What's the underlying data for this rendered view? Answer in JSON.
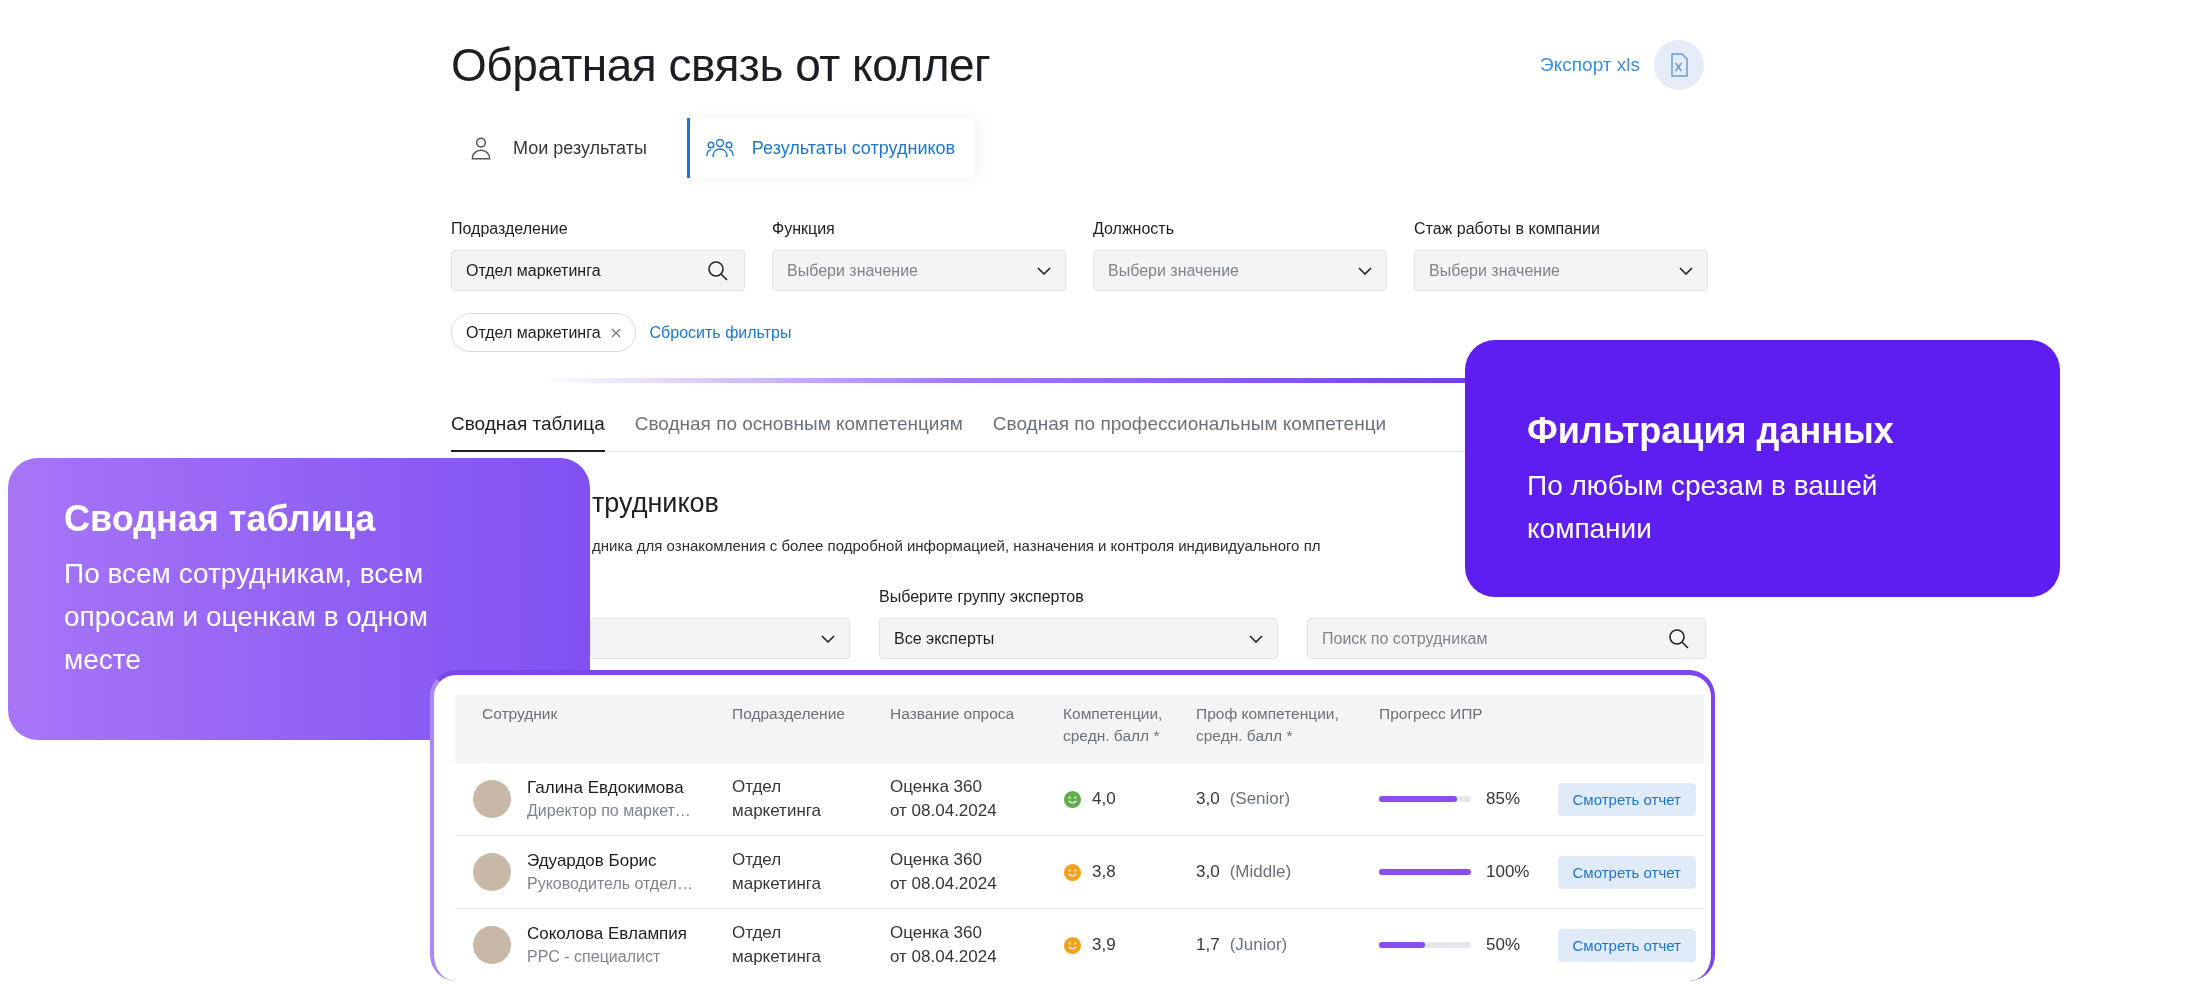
{
  "page": {
    "title": "Обратная связь от коллег",
    "export": "Экспорт xls"
  },
  "tabs": [
    {
      "label": "Мои результаты",
      "selected": false,
      "kind": "personal"
    },
    {
      "label": "Результаты сотрудников",
      "selected": true,
      "kind": "team"
    }
  ],
  "filters": [
    {
      "label": "Подразделение",
      "kind": "search",
      "value": "Отдел маркетинга"
    },
    {
      "label": "Функция",
      "kind": "select",
      "placeholder": "Выбери значение"
    },
    {
      "label": "Должность",
      "kind": "select",
      "placeholder": "Выбери значение"
    },
    {
      "label": "Стаж работы в компании",
      "kind": "select",
      "placeholder": "Выбери значение"
    }
  ],
  "chips": [
    {
      "label": "Отдел маркетинга"
    }
  ],
  "reset": "Сбросить фильтры",
  "subtabs": [
    {
      "label": "Сводная таблица",
      "selected": true
    },
    {
      "label": "Сводная по основным компетенциям",
      "selected": false
    },
    {
      "label": "Сводная по профессиональным компетенци",
      "selected": false
    }
  ],
  "section": {
    "title": "трудников",
    "description": "дника для ознакомления с более подробной информацией, назначения и контроля индивидуального пл"
  },
  "expert_filters": [
    {
      "kind": "select"
    },
    {
      "kind": "select",
      "label": "Выберите группу экспертов",
      "value": "Все эксперты"
    },
    {
      "kind": "search",
      "placeholder": "Поиск по сотрудникам"
    }
  ],
  "table": {
    "columns": [
      "Сотрудник",
      "Подразделение",
      "Название опроса",
      "Компетенции, средн. балл *",
      "Проф компетенции, средн. балл *",
      "Прогресс ИПР"
    ],
    "rows": [
      {
        "name": "Галина Евдокимова",
        "position": "Директор по маркет…",
        "department": "Отдел\nмаркетинга",
        "survey": "Оценка 360\nот 08.04.2024",
        "color": "#5fb04a",
        "competence": "4,0",
        "prof_score": "3,0",
        "prof_level": "(Senior)",
        "level": 0.85,
        "progress": "85%",
        "action": "Смотреть отчет"
      },
      {
        "name": "Эдуардов Борис",
        "position": "Руководитель отдел…",
        "department": "Отдел\nмаркетинга",
        "survey": "Оценка 360\nот 08.04.2024",
        "color": "#f5a11c",
        "competence": "3,8",
        "prof_score": "3,0",
        "prof_level": "(Middle)",
        "level": 1.0,
        "progress": "100%",
        "action": "Смотреть отчет"
      },
      {
        "name": "Соколова Евлампия",
        "position": "PPC - специалист",
        "department": "Отдел\nмаркетинга",
        "survey": "Оценка 360\nот 08.04.2024",
        "color": "#f5a11c",
        "competence": "3,9",
        "prof_score": "1,7",
        "prof_level": "(Junior)",
        "level": 0.5,
        "progress": "50%",
        "action": "Смотреть отчет"
      }
    ]
  },
  "callouts": [
    {
      "kind": "left",
      "title": "Сводная таблица",
      "text": "По всем сотрудникам, всем опросам и оценкам в одном месте"
    },
    {
      "kind": "right",
      "title": "Фильтрация данных",
      "text": "По любым срезам в вашей компании"
    }
  ]
}
